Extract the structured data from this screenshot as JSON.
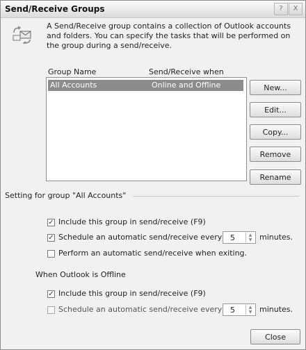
{
  "window": {
    "title": "Send/Receive Groups",
    "help_label": "?",
    "close_label": "X"
  },
  "intro": {
    "icon": "send-receive-groups-icon",
    "description": "A Send/Receive group contains a collection of Outlook accounts and folders. You can specify the tasks that will be performed on the group during a send/receive."
  },
  "groups_list": {
    "columns": [
      "Group Name",
      "Send/Receive when"
    ],
    "rows": [
      {
        "name": "All Accounts",
        "when": "Online and Offline",
        "selected": true
      }
    ]
  },
  "buttons": {
    "new": "New...",
    "edit": "Edit...",
    "copy": "Copy...",
    "remove": "Remove",
    "rename": "Rename",
    "close": "Close"
  },
  "settings": {
    "group_label": "Setting for group \"All Accounts\"",
    "online": {
      "include": {
        "label": "Include this group in send/receive (F9)",
        "checked": true
      },
      "schedule": {
        "label": "Schedule an automatic send/receive every",
        "checked": true,
        "value": "5",
        "suffix": "minutes."
      },
      "on_exit": {
        "label": "Perform an automatic send/receive when exiting.",
        "checked": false
      }
    },
    "offline_label": "When Outlook is Offline",
    "offline": {
      "include": {
        "label": "Include this group in send/receive (F9)",
        "checked": true
      },
      "schedule": {
        "label": "Schedule an automatic send/receive every",
        "checked": false,
        "value": "5",
        "suffix": "minutes."
      }
    }
  }
}
